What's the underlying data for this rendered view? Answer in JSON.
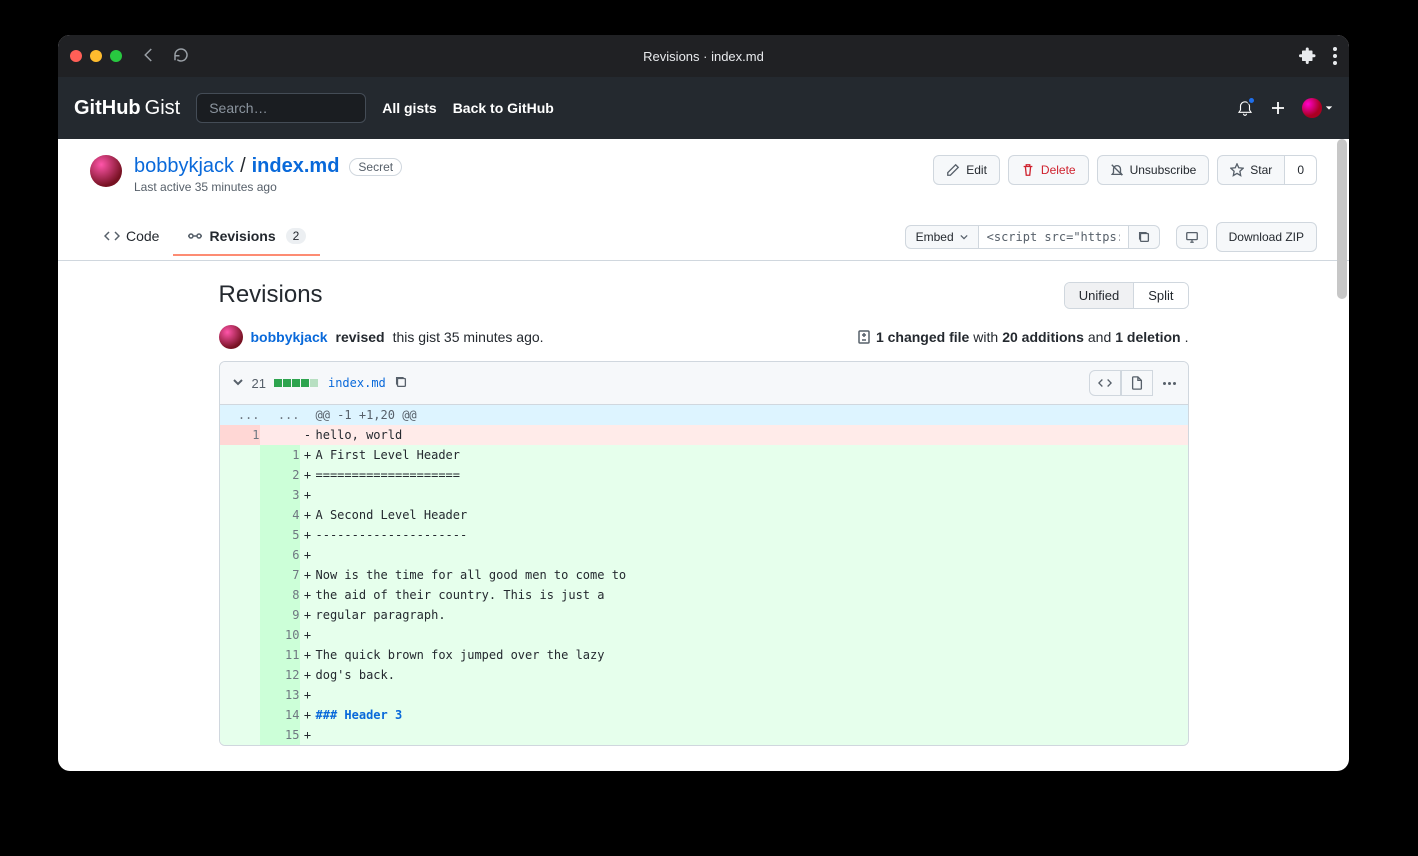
{
  "browser": {
    "title": "Revisions · index.md"
  },
  "header": {
    "search_placeholder": "Search…",
    "nav_all_gists": "All gists",
    "nav_back": "Back to GitHub"
  },
  "gist": {
    "owner": "bobbykjack",
    "filename": "index.md",
    "badge": "Secret",
    "last_active": "Last active 35 minutes ago",
    "actions": {
      "edit": "Edit",
      "delete": "Delete",
      "unsubscribe": "Unsubscribe",
      "star": "Star",
      "star_count": "0"
    }
  },
  "tabs": {
    "code": "Code",
    "revisions": "Revisions",
    "revisions_count": "2",
    "embed_label": "Embed",
    "embed_value": "<script src=\"https://",
    "download": "Download ZIP"
  },
  "revisions_page": {
    "heading": "Revisions",
    "view_unified": "Unified",
    "view_split": "Split",
    "line_user": "bobbykjack",
    "line_revised": "revised",
    "line_text": " this gist 35 minutes ago.",
    "changed_files": "1 changed file",
    "with_text": " with ",
    "additions": "20 additions",
    "and_text": " and ",
    "deletions": "1 deletion",
    "period": "."
  },
  "diff": {
    "count": "21",
    "filename": "index.md",
    "hunk": "@@ -1 +1,20 @@",
    "deletions": [
      {
        "old": "1",
        "text": "hello, world"
      }
    ],
    "additions": [
      {
        "new": "1",
        "text": "A First Level Header"
      },
      {
        "new": "2",
        "text": "===================="
      },
      {
        "new": "3",
        "text": ""
      },
      {
        "new": "4",
        "text": "A Second Level Header"
      },
      {
        "new": "5",
        "text": "---------------------"
      },
      {
        "new": "6",
        "text": ""
      },
      {
        "new": "7",
        "text": "Now is the time for all good men to come to"
      },
      {
        "new": "8",
        "text": "the aid of their country. This is just a"
      },
      {
        "new": "9",
        "text": "regular paragraph."
      },
      {
        "new": "10",
        "text": ""
      },
      {
        "new": "11",
        "text": "The quick brown fox jumped over the lazy"
      },
      {
        "new": "12",
        "text": "dog's back."
      },
      {
        "new": "13",
        "text": ""
      },
      {
        "new": "14",
        "text": "### Header 3",
        "style": "md"
      },
      {
        "new": "15",
        "text": ""
      }
    ]
  }
}
